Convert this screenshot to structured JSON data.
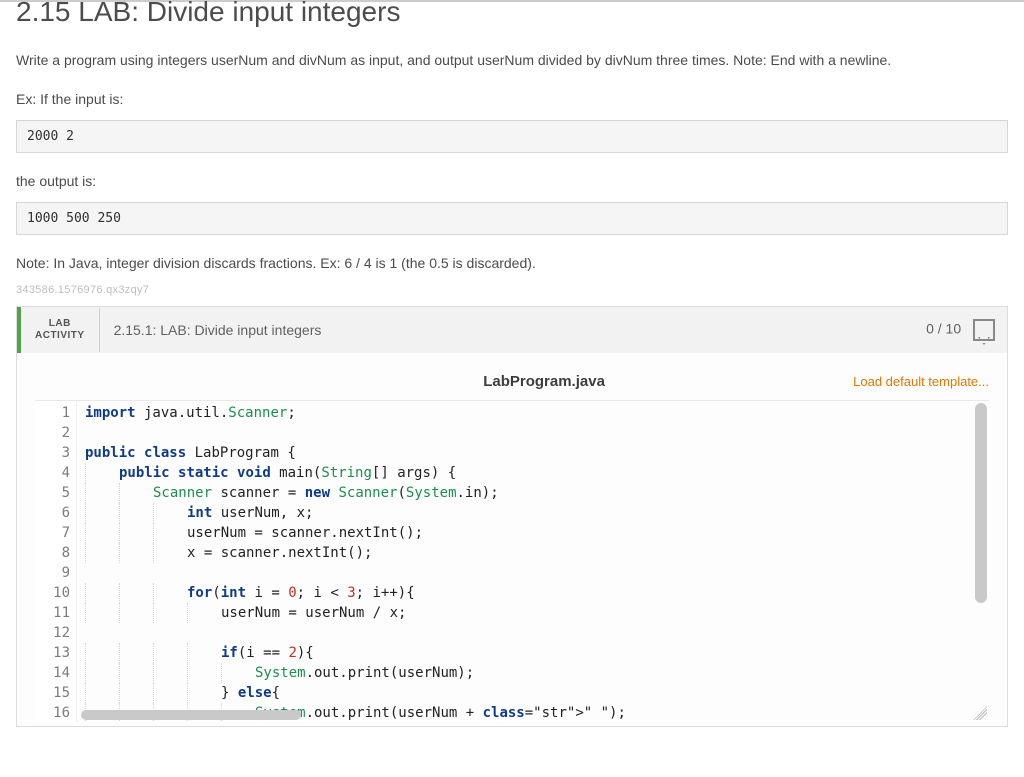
{
  "header": {
    "title": "2.15 LAB: Divide input integers"
  },
  "description": {
    "p1": "Write a program using integers userNum and divNum as input, and output userNum divided by divNum three times. Note: End with a newline.",
    "ex_intro": "Ex: If the input is:",
    "input_example": "2000 2",
    "output_intro": "the output is:",
    "output_example": "1000 500 250",
    "note": "Note: In Java, integer division discards fractions. Ex: 6 / 4 is 1 (the 0.5 is discarded).",
    "watermark": "343586.1576976.qx3zqy7"
  },
  "activity": {
    "badge_top": "LAB",
    "badge_bottom": "ACTIVITY",
    "title": "2.15.1: LAB: Divide input integers",
    "score": "0 / 10",
    "filename": "LabProgram.java",
    "load_template": "Load default template..."
  },
  "code": {
    "lines": [
      "import java.util.Scanner;",
      "",
      "public class LabProgram {",
      "    public static void main(String[] args) {",
      "        Scanner scanner = new Scanner(System.in);",
      "            int userNum, x;",
      "            userNum = scanner.nextInt();",
      "            x = scanner.nextInt();",
      "",
      "            for(int i = 0; i < 3; i++){",
      "                userNum = userNum / x;",
      "",
      "                if(i == 2){",
      "                    System.out.print(userNum);",
      "                } else{",
      "                    System.out.print(userNum + \" \");"
    ],
    "line_count": 16
  }
}
